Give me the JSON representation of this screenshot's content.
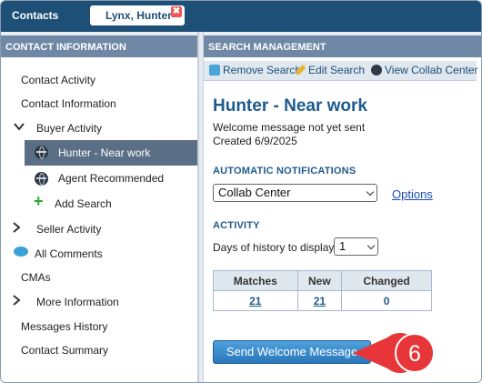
{
  "topbar": {
    "contacts_tab": "Contacts",
    "person_tab": "Lynx, Hunter",
    "close_glyph": "✖"
  },
  "left_panel": {
    "header": "CONTACT INFORMATION",
    "items": [
      {
        "label": "Contact Activity"
      },
      {
        "label": "Contact Information"
      },
      {
        "label": "Buyer Activity",
        "icon": "chevron-down-icon"
      },
      {
        "label": "Hunter - Near work",
        "icon": "globe-icon",
        "selected": true
      },
      {
        "label": "Agent Recommended",
        "icon": "globe-icon"
      },
      {
        "label": "Add Search",
        "icon": "plus-icon"
      },
      {
        "label": "Seller Activity",
        "icon": "chevron-right-icon"
      },
      {
        "label": "All Comments",
        "icon": "comment-icon"
      },
      {
        "label": "CMAs"
      },
      {
        "label": "More Information",
        "icon": "chevron-right-icon"
      },
      {
        "label": "Messages History"
      },
      {
        "label": "Contact Summary"
      }
    ]
  },
  "right_panel": {
    "header": "SEARCH MANAGEMENT",
    "toolbar": {
      "remove": "Remove Search",
      "edit": "Edit Search",
      "view_collab": "View Collab Center"
    },
    "title": "Hunter - Near work",
    "welcome_status": "Welcome message not yet sent",
    "created": "Created 6/9/2025",
    "notifications_header": "AUTOMATIC NOTIFICATIONS",
    "notifications_value": "Collab Center",
    "options_link": "Options",
    "activity_header": "ACTIVITY",
    "days_label": "Days of history to display",
    "days_value": "1",
    "table": {
      "headers": [
        "Matches",
        "New",
        "Changed"
      ],
      "values": [
        "21",
        "21",
        "0"
      ]
    },
    "send_button": "Send Welcome Message"
  },
  "callout": {
    "number": "6",
    "color": "#e8353a"
  }
}
